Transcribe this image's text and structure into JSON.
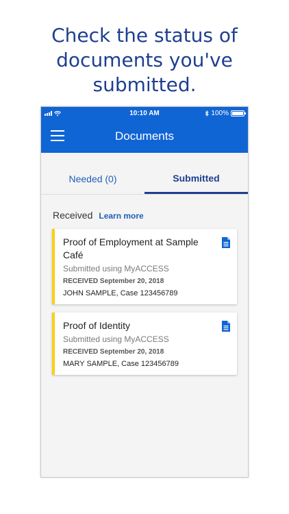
{
  "headline": {
    "line1": "Check the status of",
    "line2": "documents you've",
    "line3": "submitted."
  },
  "status_bar": {
    "time": "10:10 AM",
    "battery": "100%"
  },
  "app_bar": {
    "title": "Documents"
  },
  "tabs": [
    {
      "label": "Needed (0)",
      "active": false
    },
    {
      "label": "Submitted",
      "active": true
    }
  ],
  "section": {
    "title": "Received",
    "link": "Learn more"
  },
  "documents": [
    {
      "title": "Proof of Employment at Sample Café",
      "submitted_via": "Submitted using MyACCESS",
      "received": "RECEIVED September 20, 2018",
      "person_case": "JOHN SAMPLE, Case 123456789",
      "icon": "document-icon"
    },
    {
      "title": "Proof of Identity",
      "submitted_via": "Submitted using MyACCESS",
      "received": "RECEIVED September 20, 2018",
      "person_case": "MARY SAMPLE, Case 123456789",
      "icon": "document-icon"
    }
  ],
  "colors": {
    "brand_blue": "#1065d4",
    "heading_blue": "#1e3f8f",
    "accent_yellow": "#f7d117"
  }
}
